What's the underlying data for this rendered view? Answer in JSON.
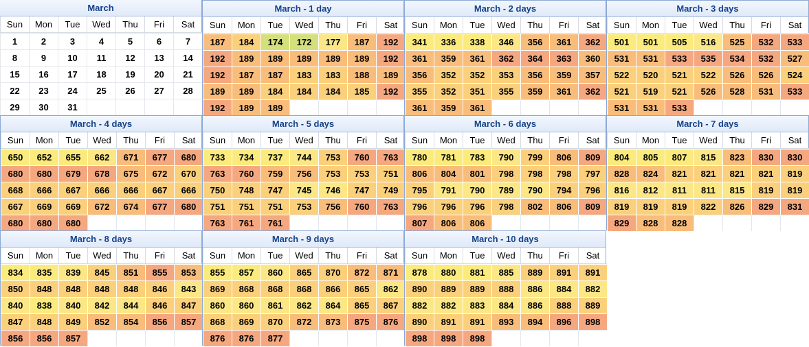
{
  "weekdays": [
    "Sun",
    "Mon",
    "Tue",
    "Wed",
    "Thu",
    "Fri",
    "Sat"
  ],
  "colors": {
    "yellow": "#fbeb7d",
    "light_yellow": "#fce787",
    "light_orange": "#fbd07c",
    "orange": "#f9bd7b",
    "peach": "#f5a880",
    "green": "#d4e07c",
    "title_text": "#15428b",
    "border": "#8da9d4"
  },
  "panels": [
    {
      "title": "March",
      "plain": true,
      "rows": [
        [
          "1",
          "2",
          "3",
          "4",
          "5",
          "6",
          "7"
        ],
        [
          "8",
          "9",
          "10",
          "11",
          "12",
          "13",
          "14"
        ],
        [
          "15",
          "16",
          "17",
          "18",
          "19",
          "20",
          "21"
        ],
        [
          "22",
          "23",
          "24",
          "25",
          "26",
          "27",
          "28"
        ],
        [
          "29",
          "30",
          "31",
          "",
          "",
          "",
          ""
        ]
      ]
    },
    {
      "title": "March - 1 day",
      "rows": [
        [
          "187",
          "184",
          "174",
          "172",
          "177",
          "187",
          "192"
        ],
        [
          "192",
          "189",
          "189",
          "189",
          "189",
          "189",
          "192"
        ],
        [
          "192",
          "187",
          "187",
          "183",
          "183",
          "188",
          "189"
        ],
        [
          "189",
          "189",
          "184",
          "184",
          "184",
          "185",
          "192"
        ],
        [
          "192",
          "189",
          "189",
          "",
          "",
          "",
          ""
        ]
      ]
    },
    {
      "title": "March - 2 days",
      "rows": [
        [
          "341",
          "336",
          "338",
          "346",
          "356",
          "361",
          "362"
        ],
        [
          "361",
          "359",
          "361",
          "362",
          "364",
          "363",
          "360"
        ],
        [
          "356",
          "352",
          "352",
          "353",
          "356",
          "359",
          "357"
        ],
        [
          "355",
          "352",
          "351",
          "355",
          "359",
          "361",
          "362"
        ],
        [
          "361",
          "359",
          "361",
          "",
          "",
          "",
          ""
        ]
      ]
    },
    {
      "title": "March - 3 days",
      "rows": [
        [
          "501",
          "501",
          "505",
          "516",
          "525",
          "532",
          "533"
        ],
        [
          "531",
          "531",
          "533",
          "535",
          "534",
          "532",
          "527"
        ],
        [
          "522",
          "520",
          "521",
          "522",
          "526",
          "526",
          "524"
        ],
        [
          "521",
          "519",
          "521",
          "526",
          "528",
          "531",
          "533"
        ],
        [
          "531",
          "531",
          "533",
          "",
          "",
          "",
          ""
        ]
      ]
    },
    {
      "title": "March - 4 days",
      "rows": [
        [
          "650",
          "652",
          "655",
          "662",
          "671",
          "677",
          "680"
        ],
        [
          "680",
          "680",
          "679",
          "678",
          "675",
          "672",
          "670"
        ],
        [
          "668",
          "666",
          "667",
          "666",
          "666",
          "667",
          "666"
        ],
        [
          "667",
          "669",
          "669",
          "672",
          "674",
          "677",
          "680"
        ],
        [
          "680",
          "680",
          "680",
          "",
          "",
          "",
          ""
        ]
      ]
    },
    {
      "title": "March - 5 days",
      "rows": [
        [
          "733",
          "734",
          "737",
          "744",
          "753",
          "760",
          "763"
        ],
        [
          "763",
          "760",
          "759",
          "756",
          "753",
          "753",
          "751"
        ],
        [
          "750",
          "748",
          "747",
          "745",
          "746",
          "747",
          "749"
        ],
        [
          "751",
          "751",
          "751",
          "753",
          "756",
          "760",
          "763"
        ],
        [
          "763",
          "761",
          "761",
          "",
          "",
          "",
          ""
        ]
      ]
    },
    {
      "title": "March - 6 days",
      "rows": [
        [
          "780",
          "781",
          "783",
          "790",
          "799",
          "806",
          "809"
        ],
        [
          "806",
          "804",
          "801",
          "798",
          "798",
          "798",
          "797"
        ],
        [
          "795",
          "791",
          "790",
          "789",
          "790",
          "794",
          "796"
        ],
        [
          "796",
          "796",
          "796",
          "798",
          "802",
          "806",
          "809"
        ],
        [
          "807",
          "806",
          "806",
          "",
          "",
          "",
          ""
        ]
      ]
    },
    {
      "title": "March - 7 days",
      "rows": [
        [
          "804",
          "805",
          "807",
          "815",
          "823",
          "830",
          "830"
        ],
        [
          "828",
          "824",
          "821",
          "821",
          "821",
          "821",
          "819"
        ],
        [
          "816",
          "812",
          "811",
          "811",
          "815",
          "819",
          "819"
        ],
        [
          "819",
          "819",
          "819",
          "822",
          "826",
          "829",
          "831"
        ],
        [
          "829",
          "828",
          "828",
          "",
          "",
          "",
          ""
        ]
      ]
    },
    {
      "title": "March - 8 days",
      "rows": [
        [
          "834",
          "835",
          "839",
          "845",
          "851",
          "855",
          "853"
        ],
        [
          "850",
          "848",
          "848",
          "848",
          "848",
          "846",
          "843"
        ],
        [
          "840",
          "838",
          "840",
          "842",
          "844",
          "846",
          "847"
        ],
        [
          "847",
          "848",
          "849",
          "852",
          "854",
          "856",
          "857"
        ],
        [
          "856",
          "856",
          "857",
          "",
          "",
          "",
          ""
        ]
      ]
    },
    {
      "title": "March - 9 days",
      "rows": [
        [
          "855",
          "857",
          "860",
          "865",
          "870",
          "872",
          "871"
        ],
        [
          "869",
          "868",
          "868",
          "868",
          "866",
          "865",
          "862"
        ],
        [
          "860",
          "860",
          "861",
          "862",
          "864",
          "865",
          "867"
        ],
        [
          "868",
          "869",
          "870",
          "872",
          "873",
          "875",
          "876"
        ],
        [
          "876",
          "876",
          "877",
          "",
          "",
          "",
          ""
        ]
      ]
    },
    {
      "title": "March - 10 days",
      "rows": [
        [
          "878",
          "880",
          "881",
          "885",
          "889",
          "891",
          "891"
        ],
        [
          "890",
          "889",
          "889",
          "888",
          "886",
          "884",
          "882"
        ],
        [
          "882",
          "882",
          "883",
          "884",
          "886",
          "888",
          "889"
        ],
        [
          "890",
          "891",
          "891",
          "893",
          "894",
          "896",
          "898"
        ],
        [
          "898",
          "898",
          "898",
          "",
          "",
          "",
          ""
        ]
      ]
    }
  ]
}
